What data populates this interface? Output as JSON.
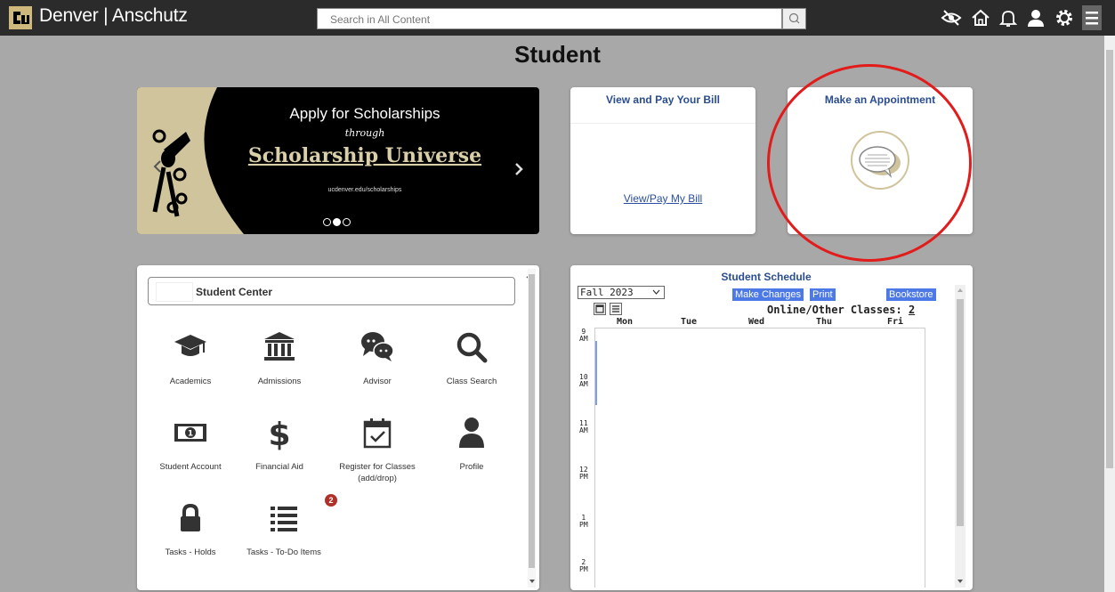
{
  "header": {
    "brand": "Denver | Anschutz",
    "search_placeholder": "Search in All Content",
    "icons": [
      "accessibility-icon",
      "home-icon",
      "bell-icon",
      "user-icon",
      "gear-icon",
      "menu-icon"
    ]
  },
  "page": {
    "title": "Student"
  },
  "banner": {
    "line1": "Apply for Scholarships",
    "line2": "through",
    "line3": "Scholarship Universe",
    "line4": "ucdenver.edu/scholarships",
    "carousel_active_index": 1,
    "carousel_count": 3
  },
  "bill_tile": {
    "title": "View and Pay Your Bill",
    "link": "View/Pay My Bill"
  },
  "appointment_tile": {
    "title": "Make an Appointment"
  },
  "student_center": {
    "title": "Student Center",
    "items": [
      {
        "label": "Academics",
        "icon": "graduation-cap-icon"
      },
      {
        "label": "Admissions",
        "icon": "institution-icon"
      },
      {
        "label": "Advisor",
        "icon": "chat-bubbles-icon"
      },
      {
        "label": "Class Search",
        "icon": "search-icon"
      },
      {
        "label": "Student Account",
        "icon": "money-icon"
      },
      {
        "label": "Financial Aid",
        "icon": "dollar-icon"
      },
      {
        "label": "Register for Classes (add/drop)",
        "icon": "calendar-check-icon"
      },
      {
        "label": "Profile",
        "icon": "user-icon"
      },
      {
        "label": "Tasks - Holds",
        "icon": "lock-icon"
      },
      {
        "label": "Tasks - To-Do Items",
        "icon": "list-icon",
        "badge": "2"
      }
    ]
  },
  "schedule": {
    "title": "Student Schedule",
    "term": "Fall 2023",
    "buttons": {
      "make_changes": "Make Changes",
      "print": "Print",
      "bookstore": "Bookstore"
    },
    "online_label": "Online/Other Classes:",
    "online_count": "2",
    "days": [
      "Mon",
      "Tue",
      "Wed",
      "Thu",
      "Fri"
    ],
    "times": [
      {
        "h": "9",
        "ap": "AM"
      },
      {
        "h": "10",
        "ap": "AM"
      },
      {
        "h": "11",
        "ap": "AM"
      },
      {
        "h": "12",
        "ap": "PM"
      },
      {
        "h": "1",
        "ap": "PM"
      },
      {
        "h": "2",
        "ap": "PM"
      }
    ]
  },
  "colors": {
    "header_bg": "#2b2b2b",
    "page_bg": "#a8a8a8",
    "link_blue": "#2a4d8f",
    "button_blue": "#4d79e6",
    "highlight_red": "#e21b1b",
    "gold": "#cfc49c"
  }
}
